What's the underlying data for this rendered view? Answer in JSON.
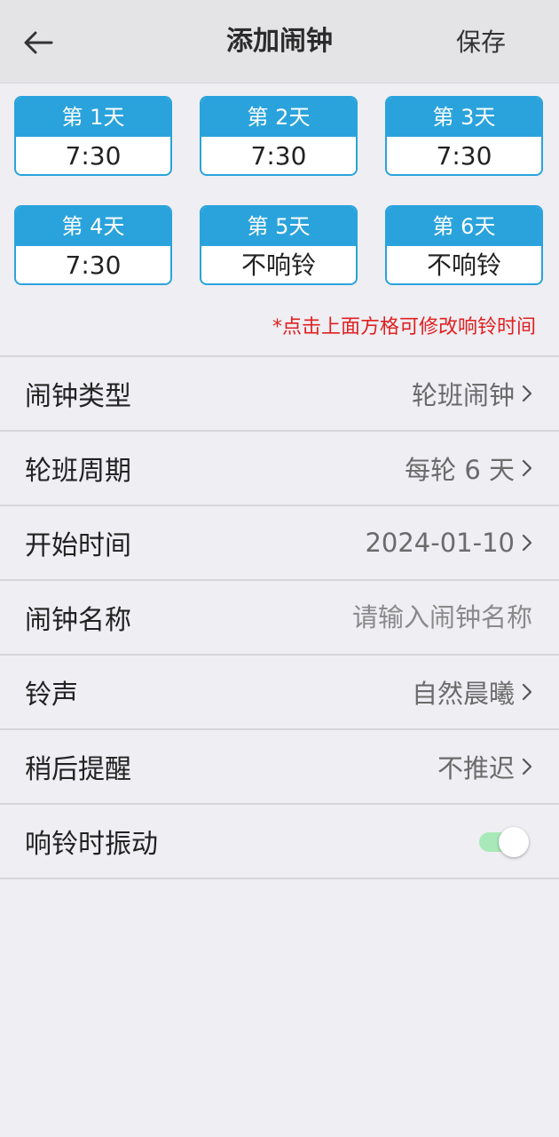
{
  "header": {
    "title": "添加闹钟",
    "save_label": "保存",
    "back_icon": "arrow-left-icon"
  },
  "days": [
    {
      "label": "第 1天",
      "value": "7:30"
    },
    {
      "label": "第 2天",
      "value": "7:30"
    },
    {
      "label": "第 3天",
      "value": "7:30"
    },
    {
      "label": "第 4天",
      "value": "7:30"
    },
    {
      "label": "第 5天",
      "value": "不响铃"
    },
    {
      "label": "第 6天",
      "value": "不响铃"
    }
  ],
  "hint": "*点击上面方格可修改响铃时间",
  "settings": {
    "alarm_type": {
      "label": "闹钟类型",
      "value": "轮班闹钟"
    },
    "cycle": {
      "label": "轮班周期",
      "value": "每轮 6 天"
    },
    "start": {
      "label": "开始时间",
      "value": "2024-01-10"
    },
    "name": {
      "label": "闹钟名称",
      "placeholder": "请输入闹钟名称"
    },
    "ringtone": {
      "label": "铃声",
      "value": "自然晨曦"
    },
    "snooze": {
      "label": "稍后提醒",
      "value": "不推迟"
    },
    "vibrate": {
      "label": "响铃时振动",
      "enabled": true
    }
  },
  "colors": {
    "accent": "#2aa3dc",
    "hint": "#e02020",
    "toggle_track": "#a9e9b8",
    "background": "#efeef3"
  }
}
